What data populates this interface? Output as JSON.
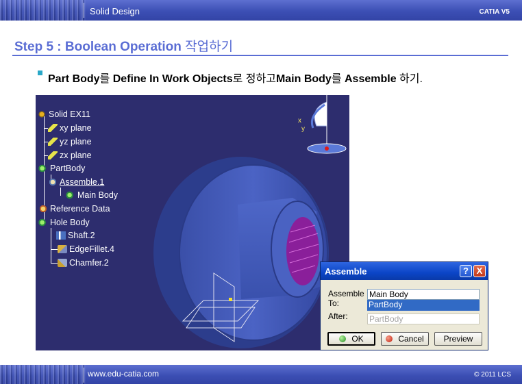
{
  "header": {
    "title": "Solid Design",
    "right_label": "CATIA V5"
  },
  "footer": {
    "left": "www.edu-catia.com",
    "right": "© 2011 LCS"
  },
  "slide": {
    "title_en": "Step 5 : Boolean Operation",
    "title_kr": "작업하기",
    "instruction": {
      "p1": "Part Body",
      "p2": "를 ",
      "p3": "Define In Work Objects",
      "p4": "로 정하고",
      "p5": "Main Body",
      "p6": "를 ",
      "p7": "Assemble",
      "p8": " 하기."
    }
  },
  "tree": {
    "root": "Solid EX11",
    "items": [
      {
        "label": "xy plane",
        "icon": "plane-icon"
      },
      {
        "label": "yz plane",
        "icon": "plane-icon"
      },
      {
        "label": "zx plane",
        "icon": "plane-icon"
      },
      {
        "label": "PartBody",
        "icon": "body-icon"
      },
      {
        "label": "Assemble.1",
        "icon": "assemble-icon"
      },
      {
        "label": "Main Body",
        "icon": "body-icon"
      },
      {
        "label": "Reference Data",
        "icon": "reference-icon"
      },
      {
        "label": "Hole Body",
        "icon": "body-icon"
      },
      {
        "label": "Shaft.2",
        "icon": "shaft-icon"
      },
      {
        "label": "EdgeFillet.4",
        "icon": "fillet-icon"
      },
      {
        "label": "Chamfer.2",
        "icon": "chamfer-icon"
      }
    ]
  },
  "compass": {
    "x_label": "x",
    "y_label": "y"
  },
  "dialog": {
    "title": "Assemble",
    "help": "?",
    "close": "X",
    "assemble_label": "Assemble",
    "to_label": "To:",
    "after_label": "After:",
    "assemble_value": "Main Body",
    "to_value": "PartBody",
    "after_value": "PartBody",
    "ok": "OK",
    "cancel": "Cancel",
    "preview": "Preview"
  }
}
